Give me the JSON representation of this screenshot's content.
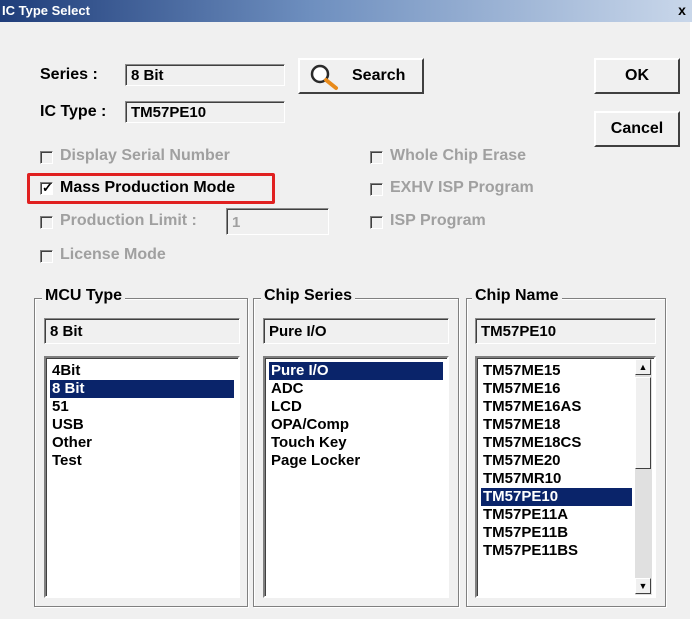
{
  "window": {
    "title": "IC Type Select",
    "close_glyph": "x"
  },
  "series": {
    "label": "Series :",
    "value": "8 Bit"
  },
  "ic_type": {
    "label": "IC Type :",
    "value": "TM57PE10"
  },
  "buttons": {
    "search": "Search",
    "ok": "OK",
    "cancel": "Cancel"
  },
  "options": {
    "display_serial_number": {
      "label": "Display Serial Number",
      "checked": false,
      "enabled": false
    },
    "mass_production_mode": {
      "label": "Mass Production Mode",
      "checked": true,
      "enabled": true
    },
    "production_limit": {
      "label": "Production Limit :",
      "value": "1",
      "checked": false,
      "enabled": false
    },
    "license_mode": {
      "label": "License Mode",
      "checked": false,
      "enabled": false
    },
    "whole_chip_erase": {
      "label": "Whole Chip Erase",
      "checked": false,
      "enabled": false
    },
    "exhv_isp_program": {
      "label": "EXHV ISP Program",
      "checked": false,
      "enabled": false
    },
    "isp_program": {
      "label": "ISP Program",
      "checked": false,
      "enabled": false
    }
  },
  "mcu_type": {
    "title": "MCU Type",
    "current": "8 Bit",
    "items": [
      "4Bit",
      "8 Bit",
      "51",
      "USB",
      "Other",
      "Test"
    ],
    "selected_index": 1
  },
  "chip_series": {
    "title": "Chip Series",
    "current": "Pure I/O",
    "items": [
      "Pure I/O",
      "ADC",
      "LCD",
      "OPA/Comp",
      "Touch Key",
      "Page Locker"
    ],
    "selected_index": 0
  },
  "chip_name": {
    "title": "Chip Name",
    "current": "TM57PE10",
    "items": [
      "TM57ME15",
      "TM57ME16",
      "TM57ME16AS",
      "TM57ME18",
      "TM57ME18CS",
      "TM57ME20",
      "TM57MR10",
      "TM57PE10",
      "TM57PE11A",
      "TM57PE11B",
      "TM57PE11BS"
    ],
    "selected_index": 7
  },
  "colors": {
    "selection": "#0a246a",
    "highlight_box": "#e02020",
    "disabled_text": "#a0a0a0"
  }
}
